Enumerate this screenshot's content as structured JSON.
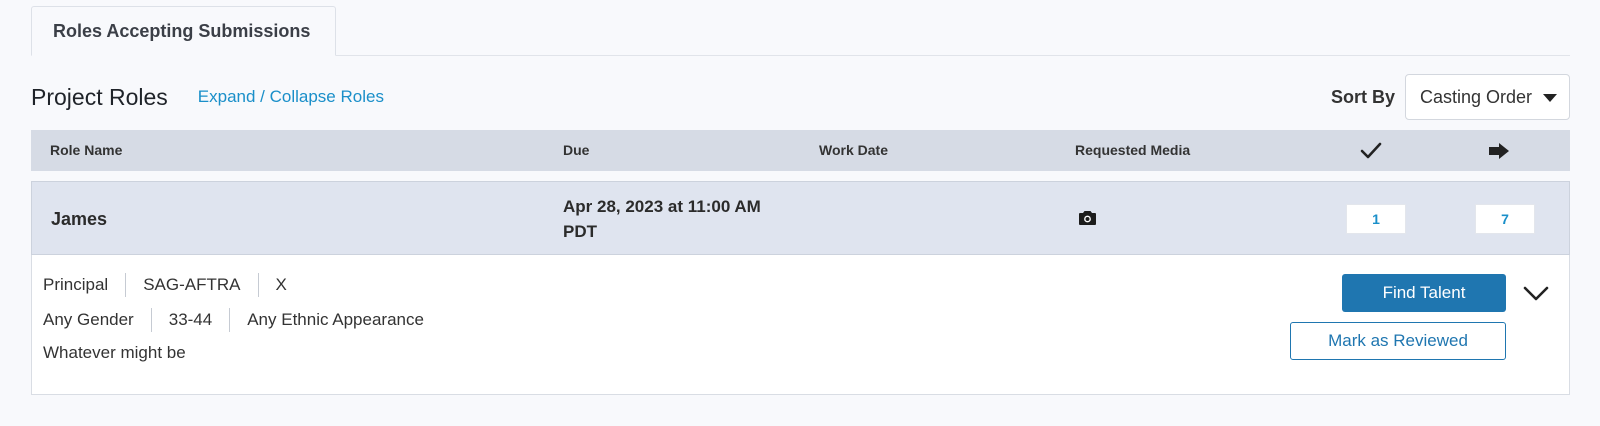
{
  "tabs": [
    {
      "label": "Roles Accepting Submissions",
      "active": true
    }
  ],
  "header": {
    "title": "Project Roles",
    "expand_link": "Expand / Collapse Roles",
    "sort_label": "Sort By",
    "sort_value": "Casting Order"
  },
  "table": {
    "columns": {
      "role_name": "Role Name",
      "due": "Due",
      "work_date": "Work Date",
      "requested_media": "Requested Media",
      "check_icon": "checkmark-icon",
      "arrow_icon": "arrow-right-icon"
    },
    "roles": [
      {
        "name": "James",
        "due_line1": "Apr 28, 2023 at 11:00 AM",
        "due_line2": "PDT",
        "work_date": "",
        "media_icon": "camera-icon",
        "check_count": "1",
        "arrow_count": "7",
        "details": {
          "line1": [
            "Principal",
            "SAG-AFTRA",
            "X"
          ],
          "line2": [
            "Any Gender",
            "33-44",
            "Any Ethnic Appearance"
          ],
          "description": "Whatever might be"
        },
        "find_talent_label": "Find Talent",
        "mark_reviewed_label": "Mark as Reviewed"
      }
    ]
  },
  "colors": {
    "accent": "#1a8fc9",
    "button_primary": "#1f76b0",
    "header_bg": "#d6dbe5",
    "row_bg": "#dfe4ef"
  }
}
